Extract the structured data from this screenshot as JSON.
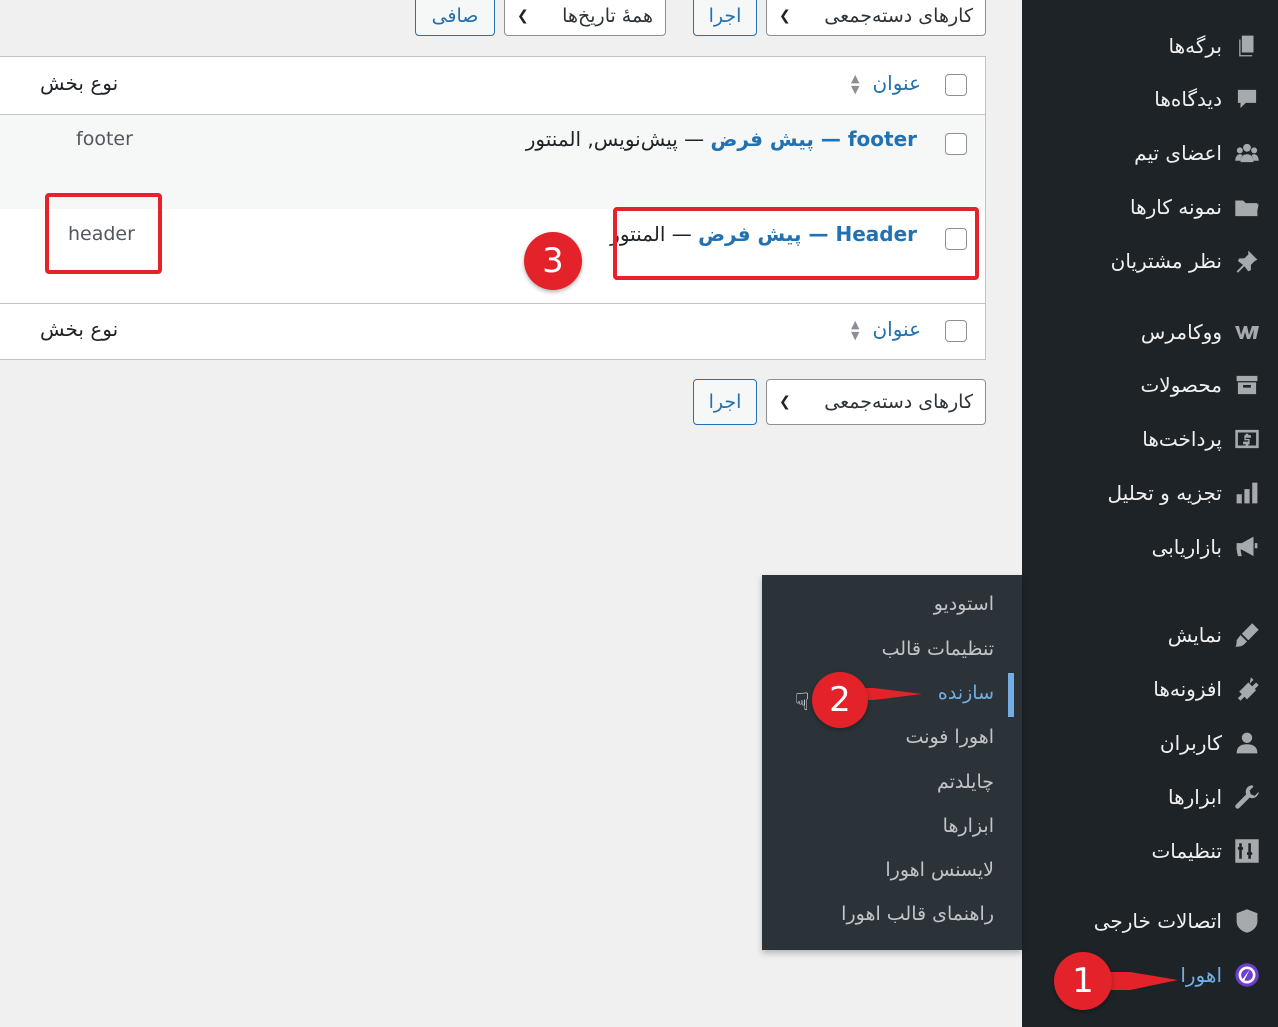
{
  "sidebar": {
    "items": [
      {
        "label": "برگه‌ها",
        "icon": "pages-icon"
      },
      {
        "label": "دیدگاه‌ها",
        "icon": "comments-icon"
      },
      {
        "label": "اعضای تیم",
        "icon": "team-icon"
      },
      {
        "label": "نمونه کارها",
        "icon": "folder-icon"
      },
      {
        "label": "نظر مشتریان",
        "icon": "pin-icon"
      },
      {
        "label": "ووکامرس",
        "icon": "woocommerce-icon"
      },
      {
        "label": "محصولات",
        "icon": "archive-icon"
      },
      {
        "label": "پرداخت‌ها",
        "icon": "payments-icon"
      },
      {
        "label": "تجزیه و تحلیل",
        "icon": "chart-icon"
      },
      {
        "label": "بازاریابی",
        "icon": "megaphone-icon"
      },
      {
        "label": "نمایش",
        "icon": "brush-icon"
      },
      {
        "label": "افزونه‌ها",
        "icon": "plugin-icon"
      },
      {
        "label": "کاربران",
        "icon": "user-icon"
      },
      {
        "label": "ابزارها",
        "icon": "wrench-icon"
      },
      {
        "label": "تنظیمات",
        "icon": "settings-icon"
      },
      {
        "label": "اتصالات خارجی",
        "icon": "shield-icon"
      },
      {
        "label": "اهورا",
        "icon": "ahura-icon"
      }
    ]
  },
  "flyout": {
    "items": [
      "استودیو",
      "تنظیمات قالب",
      "سازنده",
      "اهورا فونت",
      "چایلدتم",
      "ابزارها",
      "لایسنس اهورا",
      "راهنمای قالب اهورا"
    ],
    "active": "سازنده"
  },
  "toolbar": {
    "bulk_actions": "کارهای دسته‌جمعی",
    "apply": "اجرا",
    "all_dates": "همهٔ تاریخ‌ها",
    "filter": "صافی"
  },
  "table": {
    "col_title": "عنوان",
    "col_type": "نوع بخش",
    "rows": [
      {
        "title": "footer",
        "separator": " — ",
        "lang": "پیش فرض",
        "state": " — پیش‌نویس, المنتور",
        "type": "footer"
      },
      {
        "title": "Header",
        "separator": " — ",
        "lang": "پیش فرض",
        "state": " — المنتور",
        "type": "header"
      }
    ]
  },
  "annotations": [
    "1",
    "2",
    "3"
  ],
  "colors": {
    "accent": "#2271b1",
    "sidebar": "#1d2327",
    "flyout": "#2c3338",
    "annotation": "#e3222a"
  }
}
